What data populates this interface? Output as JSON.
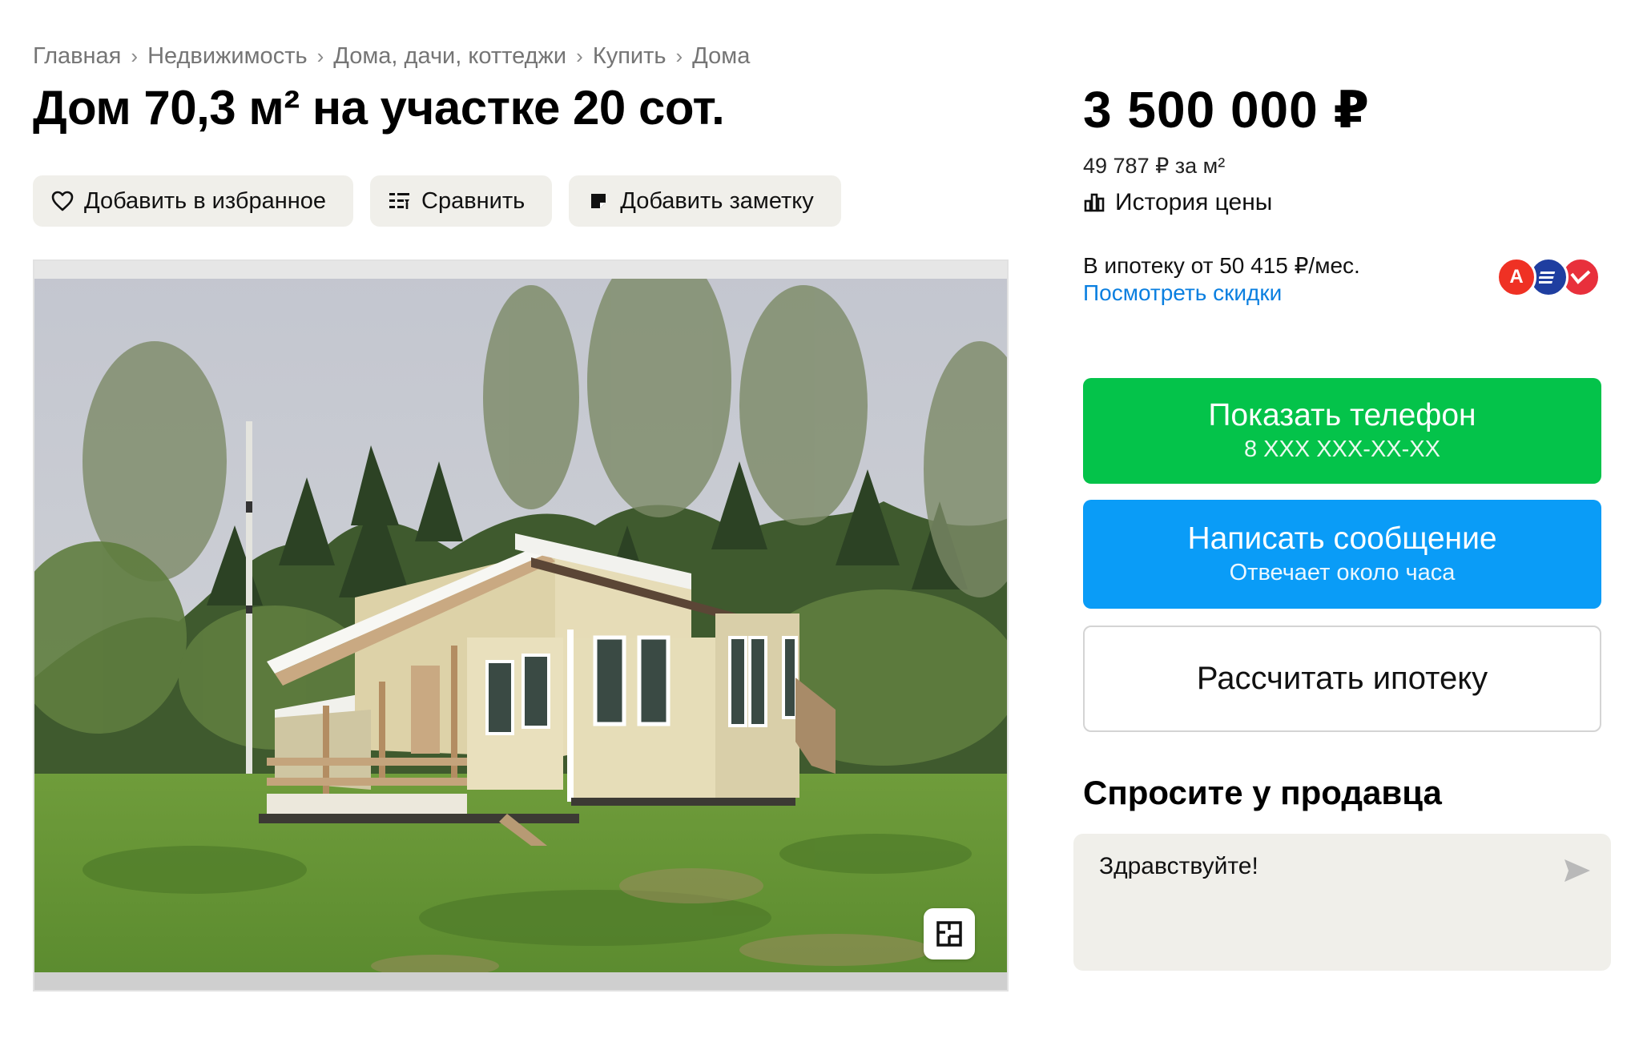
{
  "breadcrumb": [
    "Главная",
    "Недвижимость",
    "Дома, дачи, коттеджи",
    "Купить",
    "Дома"
  ],
  "title": "Дом 70,3 м² на участке 20 сот.",
  "actions": {
    "favorite": "Добавить в избранное",
    "compare": "Сравнить",
    "note": "Добавить заметку"
  },
  "price": {
    "total": "3 500 000 ₽",
    "per_m2": "49 787 ₽ за м²",
    "history": "История цены"
  },
  "mortgage": {
    "text": "В ипотеку от 50 415 ₽/мес.",
    "discounts": "Посмотреть скидки",
    "banks": [
      {
        "icon": "alfa-bank-icon",
        "letter": "А",
        "color": "#ef3124"
      },
      {
        "icon": "bank-stripes-icon",
        "letter": "",
        "color": "#1f3ea0"
      },
      {
        "icon": "bank-check-icon",
        "letter": "",
        "color": "#e8303c"
      }
    ]
  },
  "buttons": {
    "phone_label": "Показать телефон",
    "phone_sub": "8 XXX XXX-XX-XX",
    "message_label": "Написать сообщение",
    "message_sub": "Отвечает около часа",
    "mortgage_calc": "Рассчитать ипотеку"
  },
  "ask": {
    "title": "Спросите у продавца",
    "value": "Здравствуйте!"
  },
  "colors": {
    "green": "#04c34a",
    "blue": "#0a9cf7",
    "link": "#0a7fe0",
    "chip_bg": "#f0efea"
  }
}
